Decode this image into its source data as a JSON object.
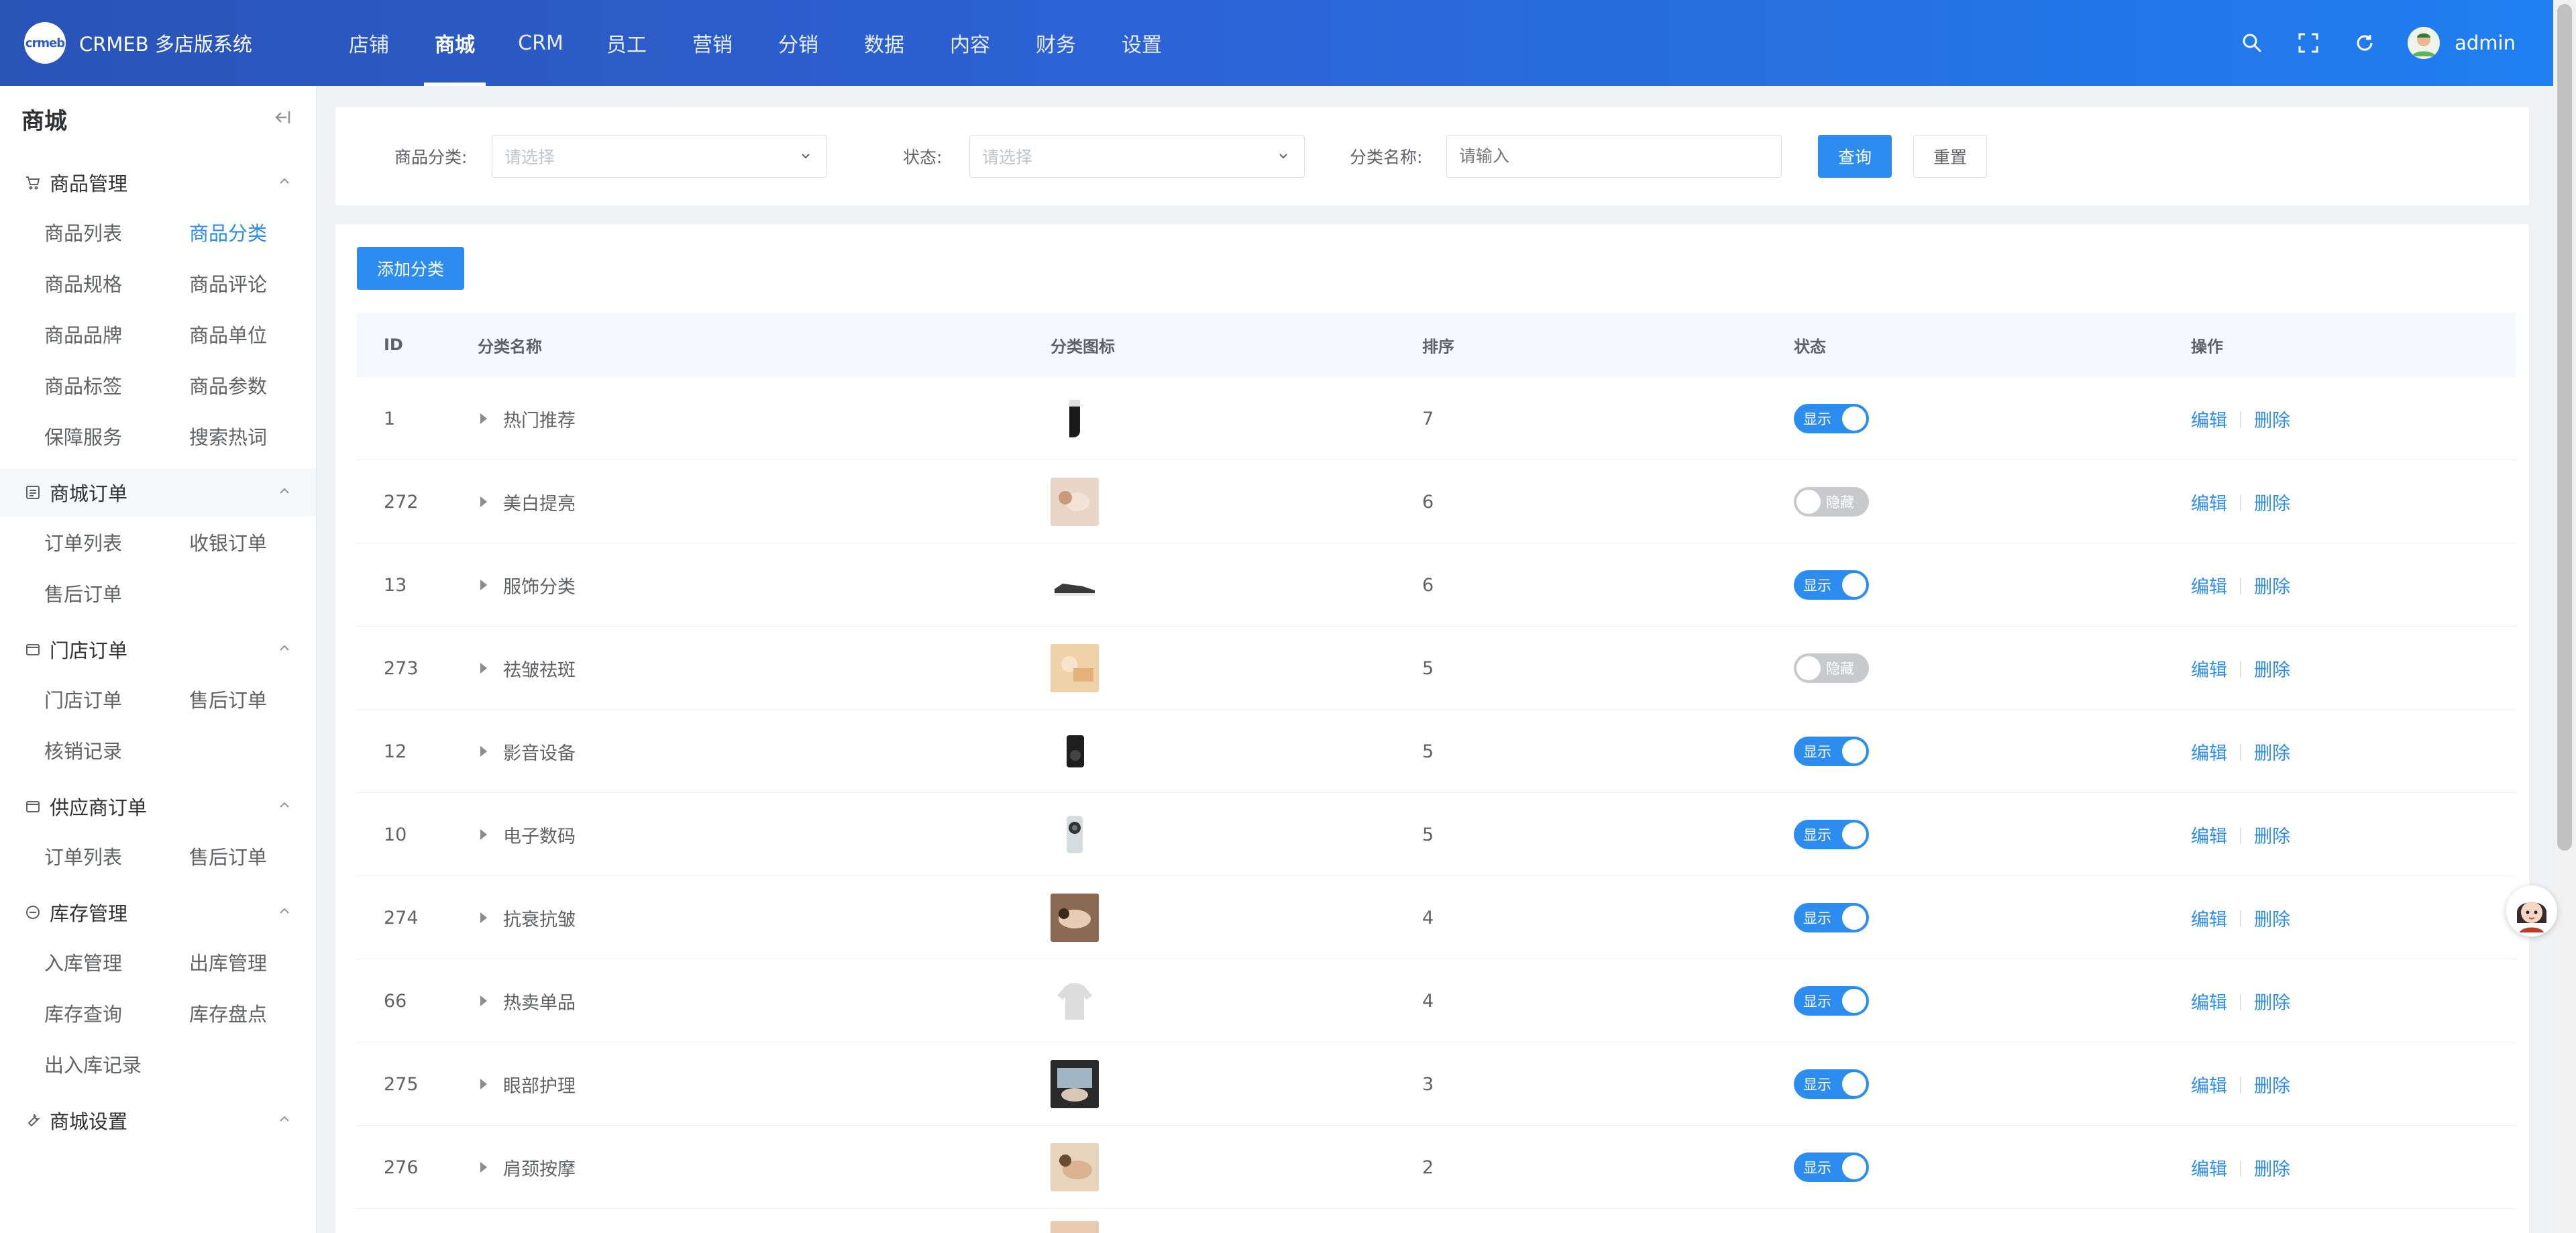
{
  "app": {
    "logo_text": "crmeb",
    "title": "CRMEB 多店版系统"
  },
  "topnav": [
    {
      "label": "店铺",
      "active": false
    },
    {
      "label": "商城",
      "active": true
    },
    {
      "label": "CRM",
      "active": false
    },
    {
      "label": "员工",
      "active": false
    },
    {
      "label": "营销",
      "active": false
    },
    {
      "label": "分销",
      "active": false
    },
    {
      "label": "数据",
      "active": false
    },
    {
      "label": "内容",
      "active": false
    },
    {
      "label": "财务",
      "active": false
    },
    {
      "label": "设置",
      "active": false
    }
  ],
  "header_right": {
    "icons": [
      "search-icon",
      "fullscreen-icon",
      "refresh-icon"
    ],
    "username": "admin"
  },
  "sidebar": {
    "title": "商城",
    "groups": [
      {
        "label": "商品管理",
        "icon": "cart-icon",
        "items": [
          "商品列表",
          "商品分类",
          "商品规格",
          "商品评论",
          "商品品牌",
          "商品单位",
          "商品标签",
          "商品参数",
          "保障服务",
          "搜索热词"
        ],
        "active_item": "商品分类"
      },
      {
        "label": "商城订单",
        "icon": "list-icon",
        "items": [
          "订单列表",
          "收银订单",
          "售后订单"
        ]
      },
      {
        "label": "门店订单",
        "icon": "folder-icon",
        "items": [
          "门店订单",
          "售后订单",
          "核销记录"
        ]
      },
      {
        "label": "供应商订单",
        "icon": "folder-icon",
        "items": [
          "订单列表",
          "售后订单"
        ]
      },
      {
        "label": "库存管理",
        "icon": "box-icon",
        "items": [
          "入库管理",
          "出库管理",
          "库存查询",
          "库存盘点",
          "出入库记录"
        ]
      },
      {
        "label": "商城设置",
        "icon": "wrench-icon",
        "items": []
      }
    ]
  },
  "filters": {
    "category_label": "商品分类:",
    "category_placeholder": "请选择",
    "status_label": "状态:",
    "status_placeholder": "请选择",
    "name_label": "分类名称:",
    "name_placeholder": "请输入",
    "query_button": "查询",
    "reset_button": "重置"
  },
  "table": {
    "add_button": "添加分类",
    "columns": [
      "ID",
      "分类名称",
      "分类图标",
      "排序",
      "状态",
      "操作"
    ],
    "switch_on_label": "显示",
    "switch_off_label": "隐藏",
    "edit_label": "编辑",
    "delete_label": "删除",
    "rows": [
      {
        "id": "1",
        "name": "热门推荐",
        "sort": "7",
        "visible": true,
        "icon": "sock-thumb"
      },
      {
        "id": "272",
        "name": "美白提亮",
        "sort": "6",
        "visible": false,
        "icon": "face-care-thumb"
      },
      {
        "id": "13",
        "name": "服饰分类",
        "sort": "6",
        "visible": true,
        "icon": "sneaker-thumb"
      },
      {
        "id": "273",
        "name": "祛皱祛斑",
        "sort": "5",
        "visible": false,
        "icon": "spa-thumb"
      },
      {
        "id": "12",
        "name": "影音设备",
        "sort": "5",
        "visible": true,
        "icon": "speaker-thumb"
      },
      {
        "id": "10",
        "name": "电子数码",
        "sort": "5",
        "visible": true,
        "icon": "phone-thumb"
      },
      {
        "id": "274",
        "name": "抗衰抗皱",
        "sort": "4",
        "visible": true,
        "icon": "massage-thumb"
      },
      {
        "id": "66",
        "name": "热卖单品",
        "sort": "4",
        "visible": true,
        "icon": "sweater-thumb"
      },
      {
        "id": "275",
        "name": "眼部护理",
        "sort": "3",
        "visible": true,
        "icon": "eye-care-thumb"
      },
      {
        "id": "276",
        "name": "肩颈按摩",
        "sort": "2",
        "visible": true,
        "icon": "shoulder-massage-thumb"
      }
    ]
  },
  "colors": {
    "primary": "#2d8cf0",
    "header_start": "#2a53b6",
    "header_end": "#1f7ff0"
  }
}
